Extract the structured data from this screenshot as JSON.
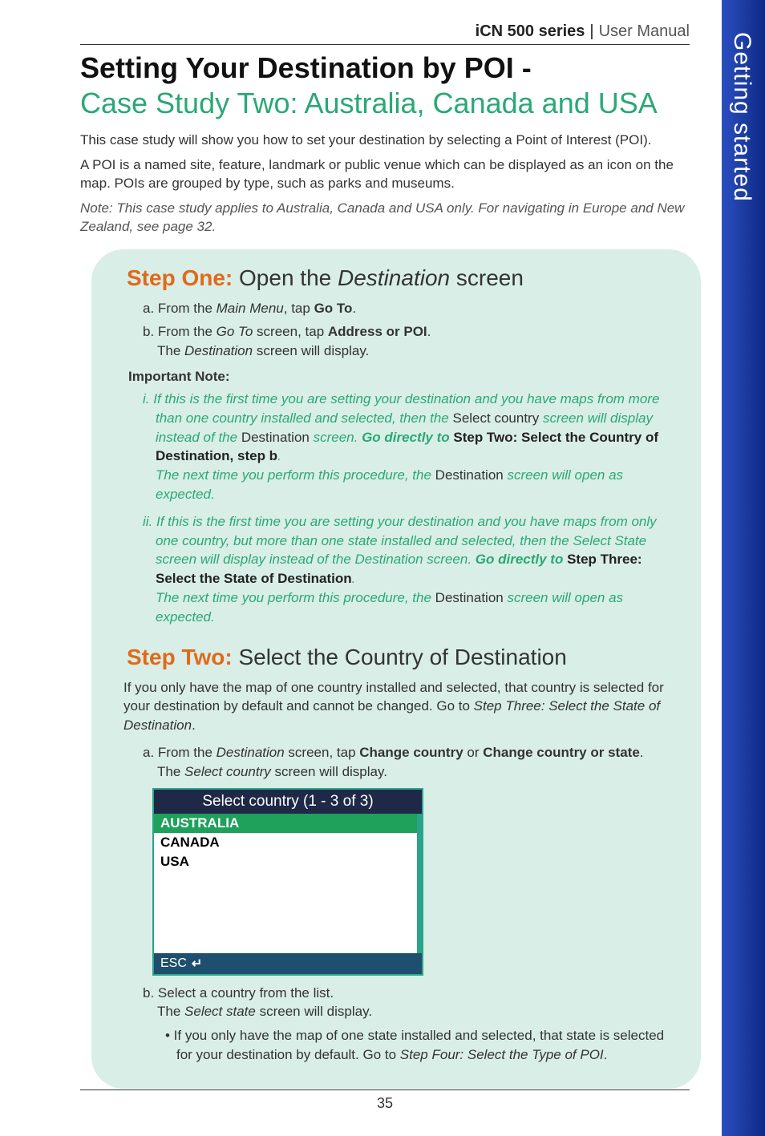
{
  "sideTab": "Getting started",
  "header": {
    "series": "iCN 500 series",
    "sep": "|",
    "manual": "User Manual"
  },
  "title1": "Setting Your Destination by POI -",
  "title2": "Case Study Two: Australia, Canada and USA",
  "intro1": "This case study will show you how to set your destination by selecting a Point of Interest (POI).",
  "intro2": "A POI is a named site, feature, landmark or public venue which can be displayed as an icon on the map. POIs are grouped by type, such as parks and museums.",
  "introNote": "Note: This case study applies to Australia, Canada and USA only. For navigating in Europe and New Zealand, see page 32.",
  "step1": {
    "label": "Step One:",
    "rest1": " Open the ",
    "restEm": "Destination",
    "rest2": " screen",
    "a": {
      "pre": "a. From the ",
      "em": "Main Menu",
      "mid": ", tap ",
      "bold": "Go To",
      "post": "."
    },
    "b": {
      "pre": "b. From the ",
      "em": "Go To",
      "mid": " screen, tap ",
      "bold": "Address or POI",
      "post": ".",
      "line2pre": "The ",
      "line2em": "Destination",
      "line2post": " screen will display."
    },
    "impLabel": "Important Note:",
    "i": {
      "prefix": "i. ",
      "g1": "If this is the first time you are setting your destination and you have maps from more than one country installed and selected, then the ",
      "up1": "Select country",
      "g2": " screen will display instead of the ",
      "up2": "Destination",
      "g3": " screen. ",
      "gb": "Go directly to ",
      "bb": "Step Two: Select the Country of Destination, step b",
      "g4": ".",
      "tail": "The next time you perform this procedure, the ",
      "tailUp": "Destination",
      "tail2": " screen will open as expected."
    },
    "ii": {
      "prefix": "ii. ",
      "g1": "If this is the first time you are setting your destination and you have maps from only one country, but more than one state installed and selected, then the Select State screen will display instead of the Destination screen. ",
      "gb": "Go directly to ",
      "bb": "Step Three: Select the State of Destination",
      "g4": ".",
      "tail": "The next time you perform this procedure, the ",
      "tailUp": "Destination",
      "tail2": " screen will open as expected."
    }
  },
  "step2": {
    "label": "Step Two:",
    "rest": " Select the Country of Destination",
    "lead1": "If you only have the map of one country installed and selected, that country is selected for your destination by default and cannot be changed. Go to ",
    "leadEm": "Step Three: Select the State of Destination",
    "lead2": ".",
    "a": {
      "pre": "a. From the ",
      "em": "Destination",
      "mid": " screen, tap ",
      "b1": "Change country",
      "or": " or ",
      "b2": "Change country or state",
      "post": ".",
      "l2pre": "The ",
      "l2em": "Select country",
      "l2post": " screen will display."
    },
    "device": {
      "title": "Select country (1 - 3 of 3)",
      "rows": [
        "AUSTRALIA",
        "CANADA",
        "USA"
      ],
      "selectedIndex": 0,
      "esc": "ESC",
      "enterGlyph": "↵"
    },
    "b": {
      "line1": "b. Select a country from the list.",
      "l2pre": "The ",
      "l2em": "Select state",
      "l2post": " screen will display."
    },
    "bullet": {
      "pre": "• If you only have the map of one state installed and selected, that state is selected for your destination by default. Go to ",
      "em": "Step Four: Select the Type of POI",
      "post": "."
    }
  },
  "pageNumber": "35"
}
